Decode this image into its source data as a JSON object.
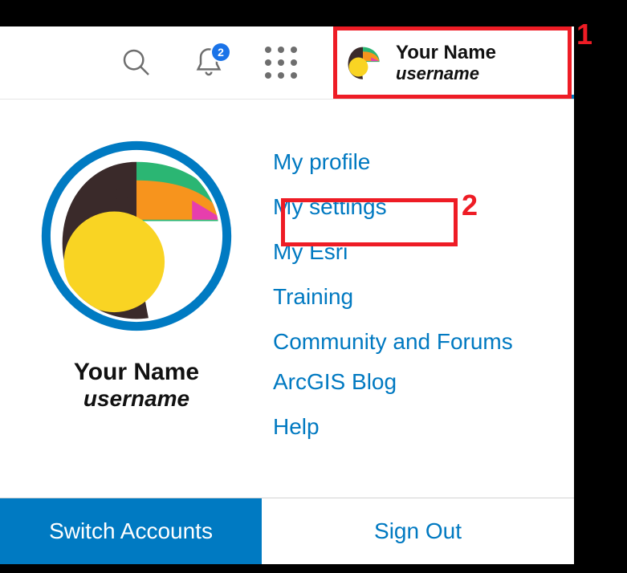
{
  "header": {
    "notification_count": "2",
    "user": {
      "display_name": "Your Name",
      "username": "username"
    }
  },
  "profile": {
    "display_name": "Your Name",
    "username": "username"
  },
  "menu": {
    "my_profile": "My profile",
    "my_settings": "My settings",
    "my_esri": "My Esri",
    "training": "Training",
    "community": "Community and Forums",
    "blog": "ArcGIS Blog",
    "help": "Help"
  },
  "footer": {
    "switch_accounts": "Switch Accounts",
    "sign_out": "Sign Out"
  },
  "annotations": {
    "step1": "1",
    "step2": "2"
  }
}
